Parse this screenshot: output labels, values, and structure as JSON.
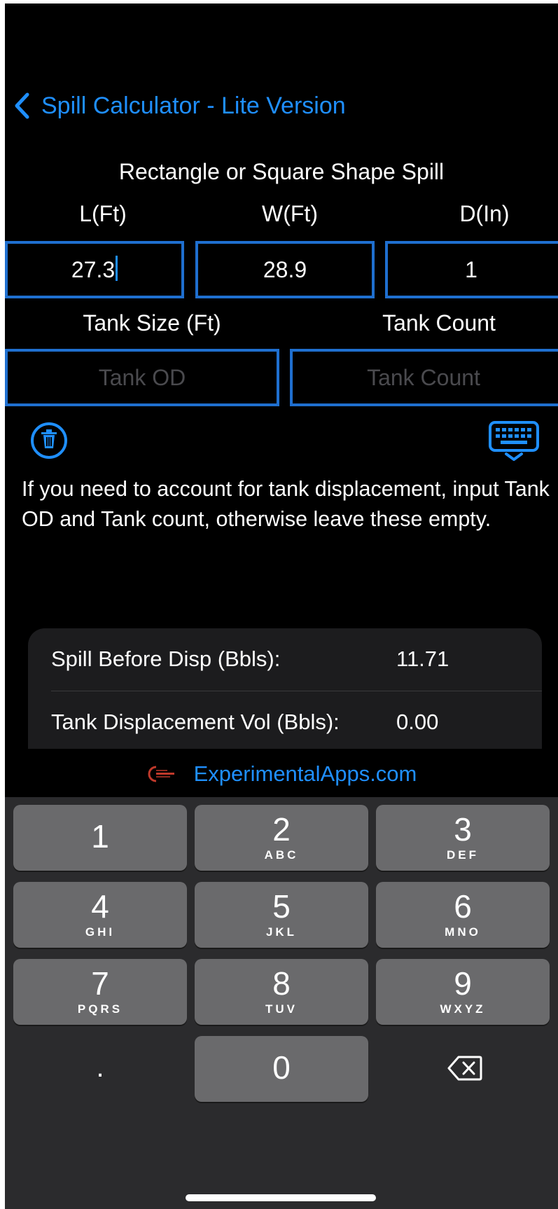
{
  "nav": {
    "title": "Spill Calculator - Lite Version"
  },
  "section_title": "Rectangle or Square Shape Spill",
  "dimensions": {
    "length_label": "L(Ft)",
    "width_label": "W(Ft)",
    "depth_label": "D(In)",
    "length_value": "27.3",
    "width_value": "28.9",
    "depth_value": "1"
  },
  "tank": {
    "size_label": "Tank Size (Ft)",
    "count_label": "Tank Count",
    "od_placeholder": "Tank OD",
    "count_placeholder": "Tank Count"
  },
  "icons": {
    "clear": "trash-icon",
    "keyboard": "keyboard-dismiss-icon",
    "back": "chevron-left-icon",
    "delete": "delete-backspace-icon"
  },
  "hint": "If you need to account for tank displacement, input Tank OD and Tank count, otherwise leave these empty.",
  "results": [
    {
      "label": "Spill Before Disp (Bbls):",
      "value": "11.71"
    },
    {
      "label": "Tank Displacement Vol (Bbls):",
      "value": "0.00"
    }
  ],
  "footer": {
    "link": "ExperimentalApps.com"
  },
  "keypad": {
    "keys": [
      {
        "digit": "1",
        "letters": ""
      },
      {
        "digit": "2",
        "letters": "ABC"
      },
      {
        "digit": "3",
        "letters": "DEF"
      },
      {
        "digit": "4",
        "letters": "GHI"
      },
      {
        "digit": "5",
        "letters": "JKL"
      },
      {
        "digit": "6",
        "letters": "MNO"
      },
      {
        "digit": "7",
        "letters": "PQRS"
      },
      {
        "digit": "8",
        "letters": "TUV"
      },
      {
        "digit": "9",
        "letters": "WXYZ"
      },
      {
        "digit": "0",
        "letters": ""
      }
    ],
    "decimal": "."
  },
  "colors": {
    "accent": "#1f8fff",
    "field_border": "#1f6fcf",
    "background": "#000000",
    "card": "#1c1c1e",
    "keyboard": "#2b2b2d",
    "key": "#6a6a6c"
  }
}
